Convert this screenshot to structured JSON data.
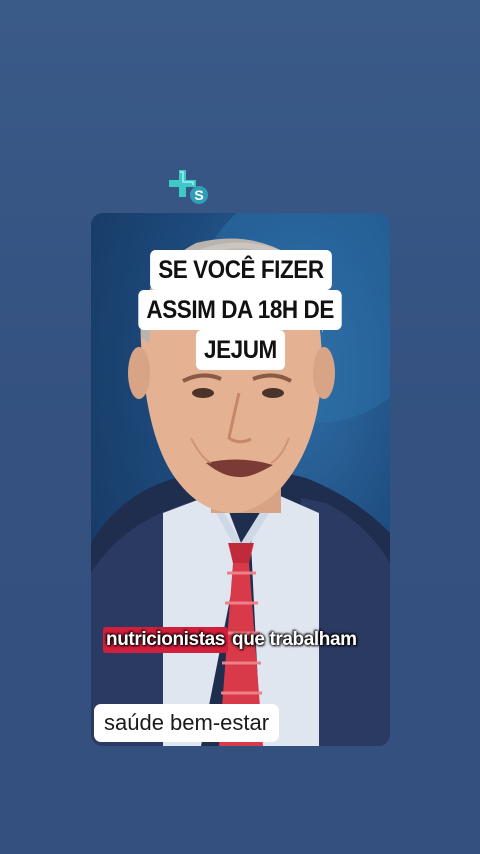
{
  "app": {
    "logo_icon": "plus-s-logo-icon",
    "accent_color": "#3fc8c8"
  },
  "video": {
    "title_lines": [
      "SE VOCÊ FIZER",
      "ASSIM DA 18H DE",
      "JEJUM"
    ],
    "subtitle_highlight": "nutricionistas",
    "subtitle_rest": "que trabalham",
    "tag_label": "saúde bem-estar",
    "highlight_color": "#d21f3c"
  }
}
